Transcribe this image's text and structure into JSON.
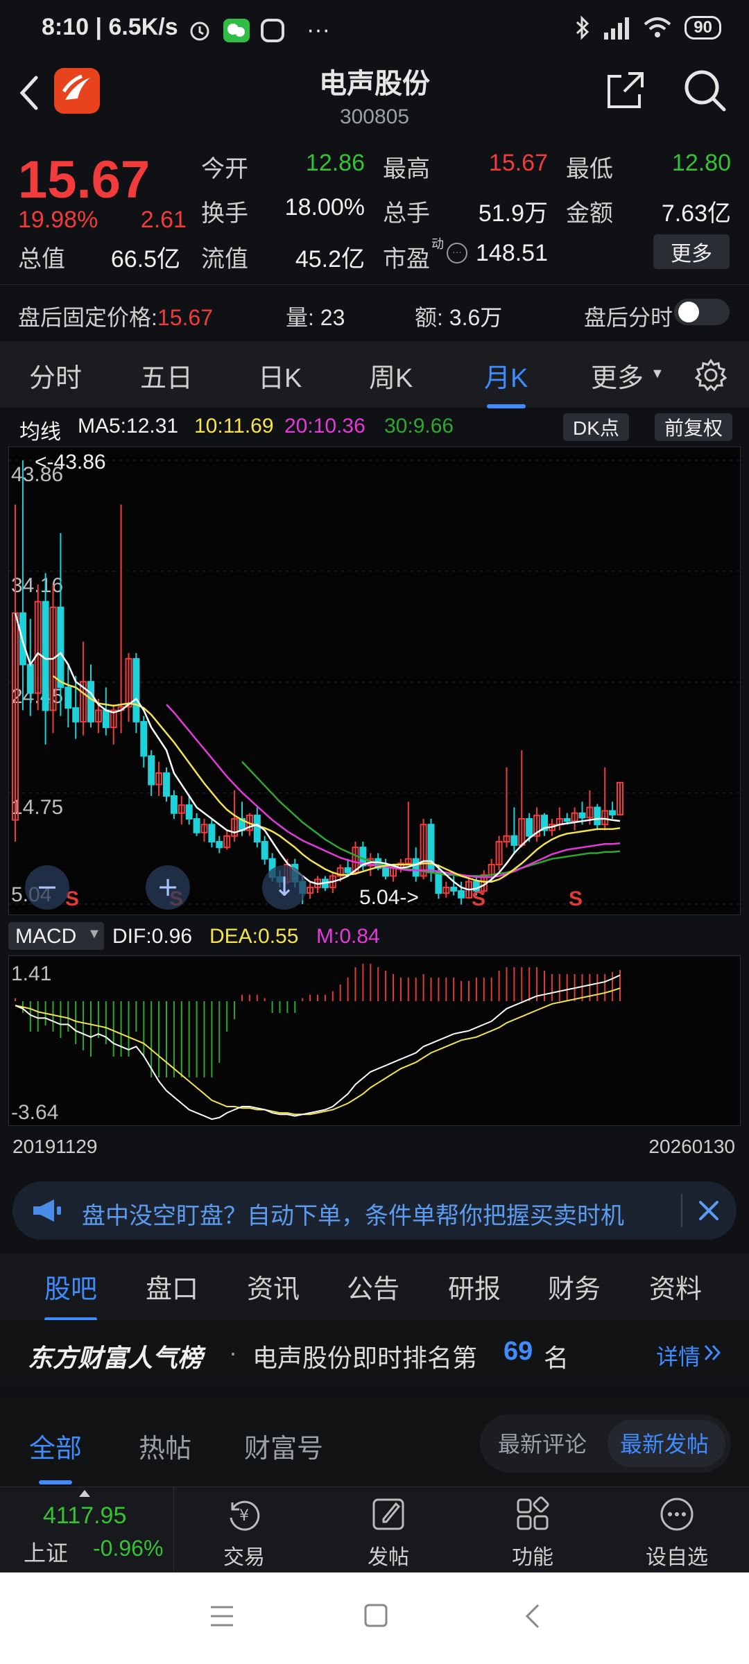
{
  "status_bar": {
    "time": "8:10 | 6.5K/s",
    "battery": "90"
  },
  "header": {
    "stock_name": "电声股份",
    "stock_code": "300805"
  },
  "quote": {
    "price": "15.67",
    "change_pct": "19.98%",
    "change_amt": "2.61",
    "fields": [
      {
        "label": "今开",
        "value": "12.86",
        "color": "green"
      },
      {
        "label": "最高",
        "value": "15.67",
        "color": "red"
      },
      {
        "label": "最低",
        "value": "12.80",
        "color": "green"
      },
      {
        "label": "换手",
        "value": "18.00%",
        "color": "white"
      },
      {
        "label": "总手",
        "value": "51.9万",
        "color": "white"
      },
      {
        "label": "金额",
        "value": "7.63亿",
        "color": "white"
      },
      {
        "label": "总值",
        "value": "66.5亿",
        "color": "white"
      },
      {
        "label": "流值",
        "value": "45.2亿",
        "color": "white"
      },
      {
        "label": "市盈",
        "value": "148.51",
        "color": "white"
      }
    ],
    "pe_superscript": "动",
    "more_label": "更多"
  },
  "after_hours": {
    "price_label": "盘后固定价格:",
    "price_value": "15.67",
    "vol_label": "量:",
    "vol_value": "23",
    "amt_label": "额:",
    "amt_value": "3.6万",
    "switch_label": "盘后分时"
  },
  "period_tabs": [
    "分时",
    "五日",
    "日K",
    "周K",
    "月K",
    "更多"
  ],
  "active_period": "月K",
  "ma_legend": {
    "title": "均线",
    "ma5": "MA5:12.31",
    "ma10": "10:11.69",
    "ma20": "20:10.36",
    "ma30": "30:9.66",
    "dk_button": "DK点",
    "adjust_button": "前复权"
  },
  "colors": {
    "up": "#f23c3c",
    "down": "#1fd1d8",
    "ma5": "#ffffff",
    "ma10": "#f5e44a",
    "ma20": "#e33ad9",
    "ma30": "#2fa82f",
    "accent": "#3f8cff"
  },
  "chart_data": [
    {
      "type": "candlestick",
      "name": "monthly-k",
      "y_ticks": [
        "43.86",
        "34.16",
        "24.45",
        "14.75",
        "5.04"
      ],
      "ylim": [
        5.04,
        43.86
      ],
      "max_annotation": "<-43.86",
      "min_annotation": "5.04->",
      "signal_labels": [
        "S",
        "S",
        "S",
        "S"
      ],
      "x_start": "20191129",
      "x_end": "20260130",
      "candles": [
        [
          12.4,
          40.0,
          10.5,
          30.5
        ],
        [
          30.5,
          43.86,
          22.0,
          26.0
        ],
        [
          26.0,
          30.0,
          21.5,
          23.5
        ],
        [
          23.5,
          33.0,
          22.0,
          31.5
        ],
        [
          31.5,
          34.0,
          19.0,
          22.0
        ],
        [
          22.0,
          33.0,
          20.0,
          31.0
        ],
        [
          31.0,
          37.5,
          21.5,
          24.0
        ],
        [
          24.0,
          26.0,
          20.5,
          22.2
        ],
        [
          22.2,
          25.0,
          19.5,
          21.0
        ],
        [
          21.0,
          28.0,
          19.8,
          24.5
        ],
        [
          24.5,
          26.0,
          20.5,
          21.0
        ],
        [
          21.0,
          23.0,
          20.0,
          22.0
        ],
        [
          22.0,
          24.0,
          19.8,
          20.5
        ],
        [
          20.5,
          22.5,
          19.0,
          22.0
        ],
        [
          22.0,
          40.0,
          20.0,
          22.3
        ],
        [
          22.3,
          27.0,
          21.0,
          26.5
        ],
        [
          26.5,
          27.0,
          20.0,
          21.0
        ],
        [
          21.0,
          21.5,
          17.0,
          18.0
        ],
        [
          18.0,
          18.5,
          14.5,
          15.5
        ],
        [
          15.5,
          17.5,
          14.5,
          16.5
        ],
        [
          16.5,
          17.0,
          14.0,
          14.5
        ],
        [
          14.5,
          15.0,
          12.5,
          13.0
        ],
        [
          13.0,
          14.5,
          12.0,
          13.7
        ],
        [
          13.7,
          14.5,
          12.0,
          12.5
        ],
        [
          12.5,
          13.0,
          11.0,
          11.3
        ],
        [
          11.3,
          12.5,
          10.5,
          12.0
        ],
        [
          12.0,
          12.5,
          10.0,
          10.5
        ],
        [
          10.5,
          11.0,
          9.5,
          10.0
        ],
        [
          10.0,
          11.5,
          9.8,
          11.0
        ],
        [
          11.0,
          15.0,
          10.5,
          12.5
        ],
        [
          12.5,
          14.0,
          11.0,
          11.5
        ],
        [
          11.5,
          13.0,
          11.0,
          12.8
        ],
        [
          12.8,
          13.5,
          10.0,
          10.5
        ],
        [
          10.5,
          11.0,
          8.5,
          9.0
        ],
        [
          9.0,
          9.5,
          7.0,
          7.4
        ],
        [
          7.4,
          8.0,
          6.5,
          7.0
        ],
        [
          7.0,
          9.0,
          6.8,
          8.5
        ],
        [
          8.5,
          9.0,
          6.5,
          7.0
        ],
        [
          7.0,
          7.5,
          5.04,
          6.0
        ],
        [
          6.0,
          7.0,
          5.5,
          6.5
        ],
        [
          6.5,
          7.5,
          6.0,
          7.2
        ],
        [
          7.2,
          7.5,
          6.2,
          6.5
        ],
        [
          6.5,
          7.8,
          6.0,
          7.5
        ],
        [
          7.5,
          8.5,
          7.0,
          8.2
        ],
        [
          8.2,
          9.0,
          7.5,
          7.8
        ],
        [
          7.8,
          10.5,
          7.6,
          10.0
        ],
        [
          10.0,
          10.5,
          8.0,
          8.4
        ],
        [
          8.4,
          9.5,
          7.5,
          9.0
        ],
        [
          9.0,
          9.5,
          8.0,
          8.2
        ],
        [
          8.2,
          9.0,
          7.2,
          7.5
        ],
        [
          7.5,
          8.5,
          7.0,
          8.2
        ],
        [
          8.2,
          9.0,
          7.8,
          8.6
        ],
        [
          8.6,
          14.0,
          8.5,
          9.0
        ],
        [
          9.0,
          10.0,
          7.0,
          7.5
        ],
        [
          7.5,
          12.5,
          7.2,
          12.0
        ],
        [
          12.0,
          12.5,
          7.0,
          7.8
        ],
        [
          7.8,
          8.5,
          5.5,
          6.0
        ],
        [
          6.0,
          7.0,
          5.6,
          6.5
        ],
        [
          6.5,
          7.5,
          5.8,
          6.2
        ],
        [
          6.2,
          7.0,
          5.0,
          5.6
        ],
        [
          5.6,
          7.5,
          5.5,
          7.0
        ],
        [
          7.0,
          7.5,
          5.8,
          6.2
        ],
        [
          6.2,
          8.0,
          6.0,
          7.6
        ],
        [
          7.6,
          9.0,
          7.0,
          8.5
        ],
        [
          8.5,
          11.0,
          8.0,
          10.5
        ],
        [
          10.5,
          17.0,
          10.0,
          11.0
        ],
        [
          11.0,
          13.5,
          9.5,
          10.2
        ],
        [
          10.2,
          18.5,
          10.0,
          12.5
        ],
        [
          12.5,
          13.0,
          10.5,
          11.0
        ],
        [
          11.0,
          13.5,
          10.5,
          12.8
        ],
        [
          12.8,
          13.0,
          11.0,
          11.5
        ],
        [
          11.5,
          12.5,
          11.0,
          12.0
        ],
        [
          12.0,
          13.5,
          11.5,
          12.5
        ],
        [
          12.5,
          13.0,
          12.0,
          12.3
        ],
        [
          12.3,
          13.5,
          11.5,
          13.0
        ],
        [
          13.0,
          14.0,
          12.0,
          12.6
        ],
        [
          12.6,
          15.0,
          12.0,
          13.5
        ],
        [
          13.5,
          13.8,
          11.5,
          12.0
        ],
        [
          12.0,
          17.0,
          11.5,
          13.2
        ],
        [
          13.2,
          14.0,
          12.5,
          12.86
        ],
        [
          12.86,
          15.67,
          12.8,
          15.67
        ]
      ],
      "ma5": [
        30.5,
        28.0,
        26.0,
        27.0,
        26.5,
        26.5,
        27.0,
        26.0,
        24.5,
        24.0,
        23.5,
        22.5,
        22.0,
        21.8,
        22.0,
        22.5,
        23.0,
        22.0,
        20.5,
        19.5,
        18.5,
        16.5,
        15.5,
        14.5,
        13.5,
        13.0,
        12.5,
        12.0,
        11.5,
        11.3,
        11.5,
        11.8,
        12.0,
        11.5,
        10.5,
        9.5,
        8.6,
        8.0,
        7.5,
        7.0,
        6.8,
        6.9,
        7.0,
        7.2,
        7.5,
        8.0,
        8.5,
        8.7,
        8.7,
        8.6,
        8.4,
        8.2,
        8.3,
        8.5,
        8.8,
        8.8,
        8.2,
        7.6,
        7.0,
        6.5,
        6.3,
        6.4,
        6.7,
        7.2,
        7.8,
        8.6,
        9.5,
        10.2,
        10.8,
        11.3,
        11.7,
        11.8,
        12.0,
        12.1,
        12.2,
        12.3,
        12.4,
        12.5,
        12.5,
        12.4,
        12.31
      ],
      "ma10": [
        null,
        null,
        null,
        null,
        null,
        25.0,
        24.5,
        24.2,
        24.0,
        23.5,
        23.0,
        22.6,
        22.5,
        22.4,
        22.5,
        22.6,
        22.5,
        22.2,
        21.6,
        20.8,
        20.0,
        19.2,
        18.3,
        17.4,
        16.5,
        15.6,
        14.8,
        14.0,
        13.3,
        12.8,
        12.4,
        12.1,
        11.9,
        11.7,
        11.4,
        11.0,
        10.5,
        10.0,
        9.4,
        8.9,
        8.5,
        8.1,
        7.8,
        7.6,
        7.6,
        7.7,
        7.9,
        8.1,
        8.3,
        8.4,
        8.5,
        8.5,
        8.5,
        8.5,
        8.6,
        8.6,
        8.4,
        8.1,
        7.8,
        7.5,
        7.3,
        7.1,
        7.0,
        7.0,
        7.2,
        7.6,
        8.1,
        8.6,
        9.2,
        9.8,
        10.3,
        10.7,
        11.0,
        11.2,
        11.3,
        11.4,
        11.5,
        11.6,
        11.6,
        11.6,
        11.69
      ],
      "ma20": [
        null,
        null,
        null,
        null,
        null,
        null,
        null,
        null,
        null,
        null,
        null,
        null,
        null,
        null,
        null,
        null,
        null,
        null,
        null,
        null,
        22.5,
        21.8,
        21.0,
        20.2,
        19.4,
        18.6,
        17.8,
        17.0,
        16.2,
        15.5,
        14.8,
        14.2,
        13.6,
        13.0,
        12.4,
        11.9,
        11.4,
        11.0,
        10.6,
        10.3,
        10.0,
        9.7,
        9.4,
        9.1,
        8.9,
        8.7,
        8.6,
        8.5,
        8.4,
        8.3,
        8.2,
        8.1,
        8.0,
        8.0,
        8.0,
        8.0,
        7.9,
        7.8,
        7.7,
        7.6,
        7.5,
        7.4,
        7.4,
        7.4,
        7.5,
        7.7,
        7.9,
        8.2,
        8.5,
        8.8,
        9.1,
        9.4,
        9.6,
        9.8,
        9.9,
        10.0,
        10.1,
        10.2,
        10.3,
        10.3,
        10.36
      ],
      "ma30": [
        null,
        null,
        null,
        null,
        null,
        null,
        null,
        null,
        null,
        null,
        null,
        null,
        null,
        null,
        null,
        null,
        null,
        null,
        null,
        null,
        null,
        null,
        null,
        null,
        null,
        null,
        null,
        null,
        null,
        null,
        17.5,
        16.8,
        16.1,
        15.4,
        14.7,
        14.0,
        13.4,
        12.8,
        12.2,
        11.7,
        11.2,
        10.7,
        10.3,
        9.9,
        9.6,
        9.3,
        9.0,
        8.8,
        8.6,
        8.4,
        8.3,
        8.2,
        8.1,
        8.0,
        7.9,
        7.8,
        7.7,
        7.6,
        7.6,
        7.5,
        7.5,
        7.5,
        7.5,
        7.6,
        7.7,
        7.8,
        8.0,
        8.2,
        8.4,
        8.6,
        8.8,
        9.0,
        9.1,
        9.2,
        9.3,
        9.4,
        9.5,
        9.5,
        9.6,
        9.6,
        9.66
      ]
    },
    {
      "type": "macd",
      "name": "macd",
      "indicator_label": "MACD",
      "dif_label": "DIF:0.96",
      "dea_label": "DEA:0.55",
      "m_label": "M:0.84",
      "y_ticks": [
        "1.41",
        "-3.64"
      ],
      "ylim": [
        -3.64,
        1.41
      ],
      "dif": [
        0.0,
        -0.1,
        -0.3,
        -0.4,
        -0.4,
        -0.5,
        -0.6,
        -0.6,
        -0.8,
        -0.9,
        -1.0,
        -0.9,
        -1.0,
        -1.2,
        -1.3,
        -1.4,
        -1.3,
        -1.6,
        -2.0,
        -2.4,
        -2.7,
        -2.9,
        -3.1,
        -3.3,
        -3.4,
        -3.5,
        -3.6,
        -3.55,
        -3.4,
        -3.3,
        -3.2,
        -3.2,
        -3.25,
        -3.3,
        -3.4,
        -3.45,
        -3.45,
        -3.5,
        -3.45,
        -3.4,
        -3.35,
        -3.3,
        -3.2,
        -3.0,
        -2.8,
        -2.5,
        -2.3,
        -2.1,
        -2.0,
        -1.9,
        -1.8,
        -1.7,
        -1.6,
        -1.5,
        -1.3,
        -1.2,
        -1.1,
        -1.0,
        -0.9,
        -0.85,
        -0.8,
        -0.7,
        -0.6,
        -0.5,
        -0.3,
        -0.1,
        0.0,
        0.1,
        0.2,
        0.3,
        0.35,
        0.4,
        0.45,
        0.5,
        0.55,
        0.6,
        0.65,
        0.7,
        0.75,
        0.85,
        0.96
      ],
      "dea": [
        0.0,
        -0.05,
        -0.1,
        -0.2,
        -0.25,
        -0.3,
        -0.35,
        -0.4,
        -0.5,
        -0.55,
        -0.6,
        -0.65,
        -0.7,
        -0.8,
        -0.9,
        -1.0,
        -1.1,
        -1.2,
        -1.4,
        -1.6,
        -1.8,
        -2.0,
        -2.2,
        -2.4,
        -2.6,
        -2.8,
        -3.0,
        -3.1,
        -3.2,
        -3.2,
        -3.25,
        -3.25,
        -3.3,
        -3.3,
        -3.35,
        -3.4,
        -3.4,
        -3.45,
        -3.45,
        -3.45,
        -3.4,
        -3.35,
        -3.3,
        -3.2,
        -3.1,
        -2.95,
        -2.8,
        -2.6,
        -2.45,
        -2.3,
        -2.15,
        -2.0,
        -1.9,
        -1.8,
        -1.65,
        -1.5,
        -1.4,
        -1.3,
        -1.2,
        -1.1,
        -1.05,
        -1.0,
        -0.9,
        -0.8,
        -0.7,
        -0.55,
        -0.45,
        -0.35,
        -0.25,
        -0.15,
        -0.05,
        0.05,
        0.1,
        0.15,
        0.2,
        0.25,
        0.3,
        0.35,
        0.4,
        0.47,
        0.55
      ]
    }
  ],
  "banner": {
    "text": "盘中没空盯盘？自动下单，条件单帮你把握买卖时机"
  },
  "lower_tabs": [
    "股吧",
    "盘口",
    "资讯",
    "公告",
    "研报",
    "财务",
    "资料"
  ],
  "active_lower_tab": "股吧",
  "rank": {
    "brand": "东方财富人气榜",
    "dot": "·",
    "text": "电声股份即时排名第",
    "number": "69",
    "suffix": "名",
    "link": "详情"
  },
  "feed_filters": [
    "全部",
    "热帖",
    "财富号"
  ],
  "feed_sort": [
    "最新评论",
    "最新发帖"
  ],
  "bottom_nav": {
    "index_value": "4117.95",
    "index_name": "上证",
    "index_change": "-0.96%",
    "items": [
      "交易",
      "发帖",
      "功能",
      "设自选"
    ]
  }
}
